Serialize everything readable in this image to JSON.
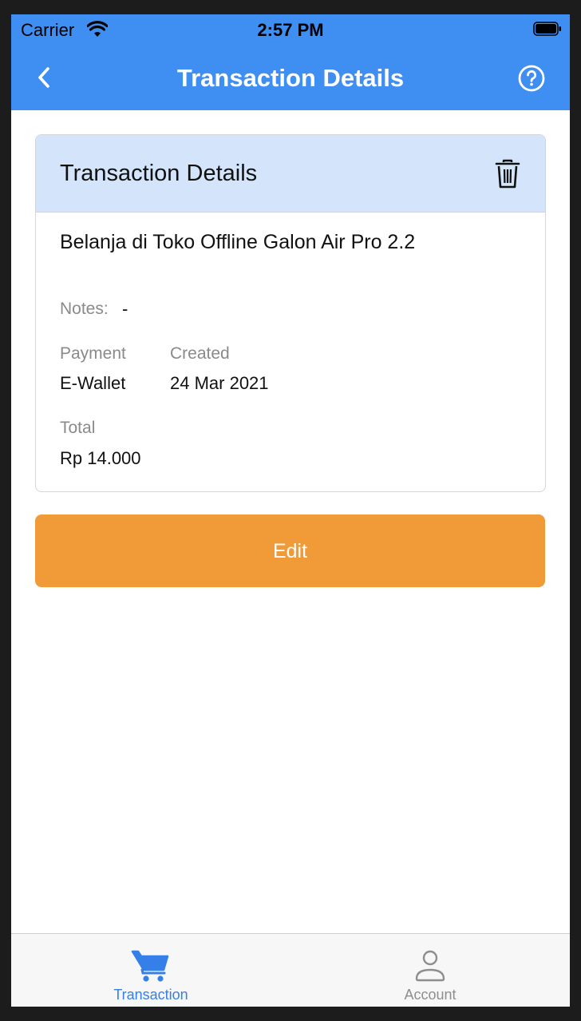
{
  "status_bar": {
    "carrier": "Carrier",
    "time": "2:57 PM"
  },
  "nav": {
    "title": "Transaction Details"
  },
  "card": {
    "header_title": "Transaction Details",
    "item_name": "Belanja di Toko Offline Galon Air Pro 2.2",
    "notes_label": "Notes:",
    "notes_value": "-",
    "payment_label": "Payment",
    "payment_value": "E-Wallet",
    "created_label": "Created",
    "created_value": "24 Mar 2021",
    "total_label": "Total",
    "total_value": "Rp 14.000"
  },
  "actions": {
    "edit_label": "Edit"
  },
  "tabs": [
    {
      "label": "Transaction",
      "icon": "cart-icon",
      "active": true
    },
    {
      "label": "Account",
      "icon": "person-icon",
      "active": false
    }
  ],
  "colors": {
    "primary": "#3f8ef2",
    "header_bg": "#d4e5fb",
    "edit_button": "#f09b38",
    "tab_active": "#3580e8",
    "tab_inactive": "#8e8e8e"
  }
}
